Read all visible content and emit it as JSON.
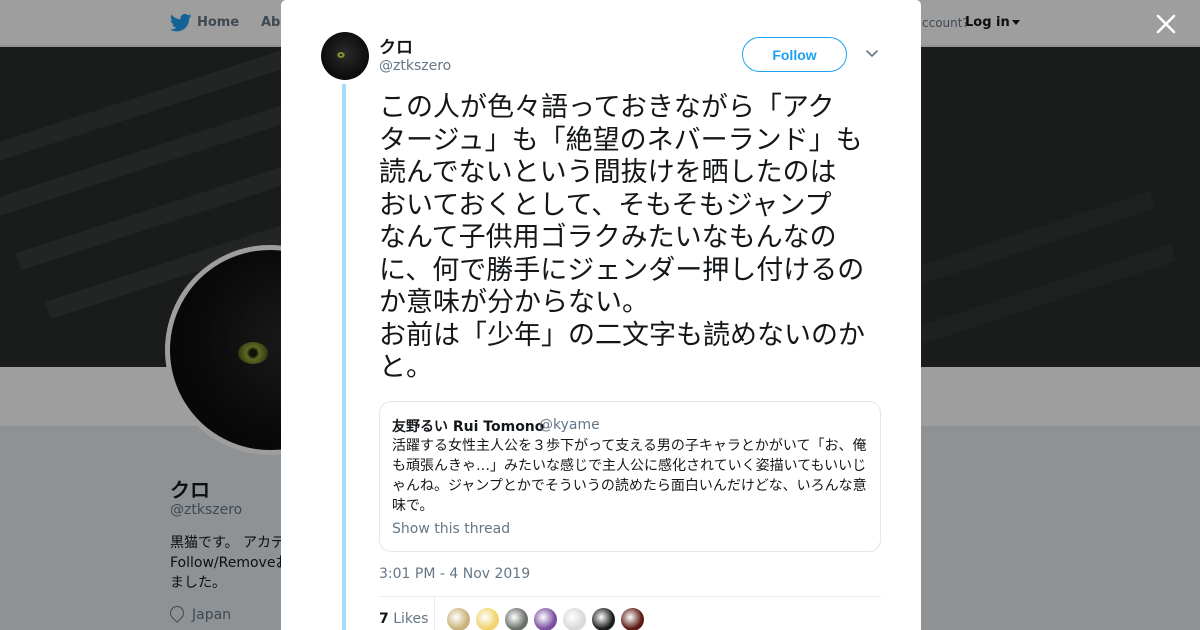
{
  "nav": {
    "home_label": "Home",
    "about_label": "Abo",
    "account_text": "ccount?",
    "login_label": "Log in"
  },
  "profile": {
    "name": "クロ",
    "handle": "@ztkszero",
    "bio_lines": [
      "黒猫です。 アカデ",
      "Follow/Removeお",
      "ました。"
    ],
    "location": "Japan"
  },
  "tweet": {
    "author_name": "クロ",
    "author_handle": "@ztkszero",
    "follow_label": "Follow",
    "text_lines": [
      "この人が色々語っておきながら「アク",
      "タージュ」も「絶望のネバーランド」も",
      "読んでないという間抜けを晒したのは",
      "おいておくとして、そもそもジャンプ",
      "なんて子供用ゴラクみたいなもんなの",
      "に、何で勝手にジェンダー押し付けるの",
      "か意味が分からない。",
      "お前は「少年」の二文字も読めないのか",
      "と。"
    ],
    "timestamp": "3:01 PM - 4 Nov 2019",
    "likes_count": "7",
    "likes_label": "Likes"
  },
  "quote": {
    "author_name": "友野るい Rui Tomono",
    "author_handle": "@kyame",
    "text_lines": [
      "活躍する女性主人公を３歩下がって支える男の子キャラとかがいて「お、俺",
      "も頑張んきゃ…」みたいな感じで主人公に感化されていく姿描いてもいいじ",
      "ゃんね。ジャンプとかでそういうの読めたら面白いんだけどな、いろんな意",
      "味で。"
    ],
    "show_thread_label": "Show this thread"
  },
  "likers": [
    {
      "icon": "liker-avatar-1",
      "color": "#c9b27a"
    },
    {
      "icon": "liker-avatar-2",
      "color": "#f0d36a"
    },
    {
      "icon": "liker-avatar-3",
      "color": "#6b6f6a"
    },
    {
      "icon": "liker-avatar-4",
      "color": "#7a4fa0"
    },
    {
      "icon": "liker-avatar-5",
      "color": "#d9d9d9"
    },
    {
      "icon": "liker-avatar-6",
      "color": "#1b1b1b"
    },
    {
      "icon": "liker-avatar-7",
      "color": "#5a1a14"
    }
  ],
  "colors": {
    "accent": "#1da1f2",
    "thread_line": "#a4d9f9",
    "text_primary": "#14171a",
    "text_secondary": "#657786"
  }
}
